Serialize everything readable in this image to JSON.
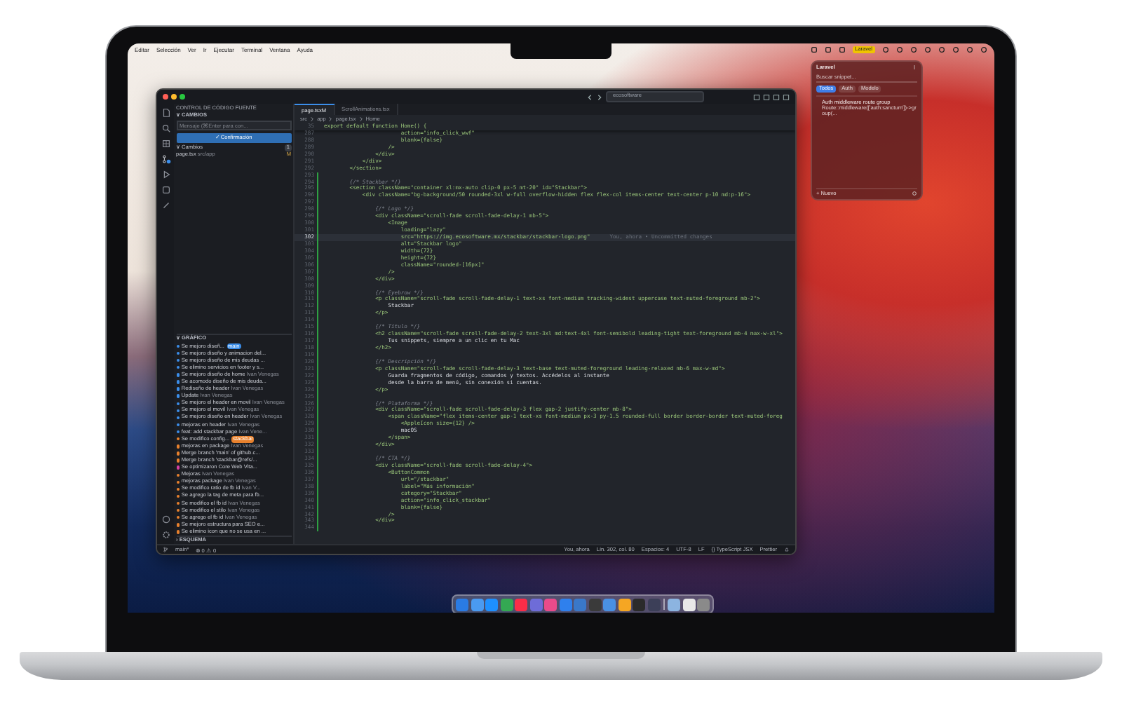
{
  "menu_bar": {
    "items": [
      "Editar",
      "Selección",
      "Ver",
      "Ir",
      "Ejecutar",
      "Terminal",
      "Ventana",
      "Ayuda"
    ],
    "active_app_label": "Laravel"
  },
  "editor_window": {
    "search": "ecosoftware",
    "sidebar": {
      "title": "CONTROL DE CÓDIGO FUENTE",
      "section": "∨ CAMBIOS",
      "message_placeholder": "Mensaje (⌘Enter para con...",
      "commit_button": "✓ Confirmación",
      "changes_label": "∨ Cambios",
      "changes_count": "1",
      "files": [
        {
          "name": "page.tsx",
          "path": "src/app",
          "status": "M"
        }
      ],
      "graph_title": "∨ GRÁFICO",
      "commits": [
        {
          "message": "Se mejoro diseñ...",
          "badge": "main",
          "color": "#3b8eea"
        },
        {
          "message": "Se mejoro diseño y animacion del...",
          "color": "#3b8eea"
        },
        {
          "message": "Se mejoro diseño de mis deudas ...",
          "color": "#3b8eea"
        },
        {
          "message": "Se elimino servicios en footer y s...",
          "color": "#3b8eea"
        },
        {
          "message": "Se mejoro diseño de home",
          "author": "Ivan Venegas",
          "color": "#3b8eea"
        },
        {
          "message": "Se acomodo diseño de mis deuda...",
          "color": "#3b8eea"
        },
        {
          "message": "Rediseño de header",
          "author": "Ivan Venegas",
          "color": "#3b8eea"
        },
        {
          "message": "Update",
          "author": "Ivan Venegas",
          "color": "#3b8eea"
        },
        {
          "message": "Se mejoro el header en movil",
          "author": "Ivan Venegas",
          "color": "#3b8eea"
        },
        {
          "message": "Se mejoro el movil",
          "author": "Ivan Venegas",
          "color": "#3b8eea"
        },
        {
          "message": "Se mejoro diseño en header",
          "author": "Ivan Venegas",
          "color": "#3b8eea"
        },
        {
          "message": "mejoras en header",
          "author": "Ivan Venegas",
          "color": "#3b8eea"
        },
        {
          "message": "feat: add stackbar page",
          "author": "Ivan Vene...",
          "color": "#3b8eea"
        },
        {
          "message": "Se modifico config...",
          "badge": "stackbar",
          "color": "#e8812d"
        },
        {
          "message": "mejoras en package",
          "author": "Ivan Venegas",
          "color": "#e8812d"
        },
        {
          "message": "Merge branch 'main' of github.c...",
          "color": "#e8812d"
        },
        {
          "message": "Merge branch 'stackbar@refs/...",
          "color": "#e8812d"
        },
        {
          "message": "Se optimizaron Core Web Vita...",
          "color": "#d63fa3"
        },
        {
          "message": "Mejoras",
          "author": "Ivan Venegas",
          "color": "#e8812d"
        },
        {
          "message": "mejoras package",
          "author": "Ivan Venegas",
          "color": "#e8812d"
        },
        {
          "message": "Se modifico ratio de fb id",
          "author": "Ivan V...",
          "color": "#e8812d"
        },
        {
          "message": "Se agrego la tag de meta para fb...",
          "color": "#e8812d"
        },
        {
          "message": "Se modifico el fb id",
          "author": "Ivan Venegas",
          "color": "#e8812d"
        },
        {
          "message": "Se modifico el stilo",
          "author": "Ivan Venegas",
          "color": "#e8812d"
        },
        {
          "message": "Se agrego el fb id",
          "author": "Ivan Venegas",
          "color": "#e8812d"
        },
        {
          "message": "Se mejoro estructura para SEO e...",
          "color": "#e8812d"
        },
        {
          "message": "Se elimino icon que no se usa en ...",
          "color": "#e8812d"
        }
      ],
      "outline_title": "› ESQUEMA"
    },
    "tabs": [
      {
        "label": "page.tsx",
        "status": "M",
        "selected": true
      },
      {
        "label": "ScrollAnimations.tsx",
        "selected": false
      }
    ],
    "breadcrumb": [
      "src",
      "app",
      "page.tsx",
      "Home"
    ],
    "lines": [
      {
        "number": "35",
        "text": "export default function Home() {",
        "kind": "markup",
        "added": false,
        "current": false
      },
      {
        "number": "287",
        "text": "                        action=\"info_click_wwf\"",
        "kind": "markup",
        "added": false,
        "current": false
      },
      {
        "number": "288",
        "text": "                        blank={false}",
        "kind": "markup",
        "added": false,
        "current": false
      },
      {
        "number": "289",
        "text": "                    />",
        "kind": "markup",
        "added": false,
        "current": false
      },
      {
        "number": "290",
        "text": "                </div>",
        "kind": "markup",
        "added": false,
        "current": false
      },
      {
        "number": "291",
        "text": "            </div>",
        "kind": "markup",
        "added": false,
        "current": false
      },
      {
        "number": "292",
        "text": "        </section>",
        "kind": "markup",
        "added": false,
        "current": false
      },
      {
        "number": "293",
        "added": true,
        "current": false
      },
      {
        "number": "294",
        "text": "        {/* Stackbar */}",
        "kind": "comment",
        "added": true,
        "current": false
      },
      {
        "number": "295",
        "text": "        <section className=\"container xl:mx-auto clip-0 px-5 mt-20\" id=\"Stackbar\">",
        "kind": "markup",
        "added": true,
        "current": false
      },
      {
        "number": "296",
        "text": "            <div className=\"bg-background/50 rounded-3xl w-full overflow-hidden flex flex-col items-center text-center p-10 md:p-16\">",
        "kind": "markup",
        "added": true,
        "current": false
      },
      {
        "number": "297",
        "added": true,
        "current": false
      },
      {
        "number": "298",
        "text": "                {/* Logo */}",
        "kind": "comment",
        "added": true,
        "current": false
      },
      {
        "number": "299",
        "text": "                <div className=\"scroll-fade scroll-fade-delay-1 mb-5\">",
        "kind": "markup",
        "added": true,
        "current": false
      },
      {
        "number": "300",
        "text": "                    <Image",
        "kind": "markup",
        "added": true,
        "current": false
      },
      {
        "number": "301",
        "text": "                        loading=\"lazy\"",
        "kind": "markup",
        "added": true,
        "current": false
      },
      {
        "number": "302",
        "text": "                        src=\"https://img.ecosoftware.mx/stackbar/stackbar-logo.png\"",
        "kind": "markup",
        "added": true,
        "current": true,
        "blame": "You, ahora • Uncommitted changes"
      },
      {
        "number": "303",
        "text": "                        alt=\"Stackbar logo\"",
        "kind": "markup",
        "added": true,
        "current": false
      },
      {
        "number": "304",
        "text": "                        width={72}",
        "kind": "markup",
        "added": true,
        "current": false
      },
      {
        "number": "305",
        "text": "                        height={72}",
        "kind": "markup",
        "added": true,
        "current": false
      },
      {
        "number": "306",
        "text": "                        className=\"rounded-[16px]\"",
        "kind": "markup",
        "added": true,
        "current": false
      },
      {
        "number": "307",
        "text": "                    />",
        "kind": "markup",
        "added": true,
        "current": false
      },
      {
        "number": "308",
        "text": "                </div>",
        "kind": "markup",
        "added": true,
        "current": false
      },
      {
        "number": "309",
        "added": true,
        "current": false
      },
      {
        "number": "310",
        "text": "                {/* Eyebrow */}",
        "kind": "comment",
        "added": true,
        "current": false
      },
      {
        "number": "311",
        "text": "                <p className=\"scroll-fade scroll-fade-delay-1 text-xs font-medium tracking-widest uppercase text-muted-foreground mb-2\">",
        "kind": "markup",
        "added": true,
        "current": false
      },
      {
        "number": "312",
        "text": "                    Stackbar",
        "kind": "text",
        "added": true,
        "current": false
      },
      {
        "number": "313",
        "text": "                </p>",
        "kind": "markup",
        "added": true,
        "current": false
      },
      {
        "number": "314",
        "added": true,
        "current": false
      },
      {
        "number": "315",
        "text": "                {/* Título */}",
        "kind": "comment",
        "added": true,
        "current": false
      },
      {
        "number": "316",
        "text": "                <h2 className=\"scroll-fade scroll-fade-delay-2 text-3xl md:text-4xl font-semibold leading-tight text-foreground mb-4 max-w-xl\">",
        "kind": "markup",
        "added": true,
        "current": false
      },
      {
        "number": "317",
        "text": "                    Tus snippets, siempre a un clic en tu Mac",
        "kind": "text",
        "added": true,
        "current": false
      },
      {
        "number": "318",
        "text": "                </h2>",
        "kind": "markup",
        "added": true,
        "current": false
      },
      {
        "number": "319",
        "added": true,
        "current": false
      },
      {
        "number": "320",
        "text": "                {/* Descripción */}",
        "kind": "comment",
        "added": true,
        "current": false
      },
      {
        "number": "321",
        "text": "                <p className=\"scroll-fade scroll-fade-delay-3 text-base text-muted-foreground leading-relaxed mb-6 max-w-md\">",
        "kind": "markup",
        "added": true,
        "current": false
      },
      {
        "number": "322",
        "text": "                    Guarda fragmentos de código, comandos y textos. Accédelos al instante",
        "kind": "text",
        "added": true,
        "current": false
      },
      {
        "number": "323",
        "text": "                    desde la barra de menú, sin conexión si cuentas.",
        "kind": "text",
        "added": true,
        "current": false
      },
      {
        "number": "324",
        "text": "                </p>",
        "kind": "markup",
        "added": true,
        "current": false
      },
      {
        "number": "325",
        "added": true,
        "current": false
      },
      {
        "number": "326",
        "text": "                {/* Plataforma */}",
        "kind": "comment",
        "added": true,
        "current": false
      },
      {
        "number": "327",
        "text": "                <div className=\"scroll-fade scroll-fade-delay-3 flex gap-2 justify-center mb-8\">",
        "kind": "markup",
        "added": true,
        "current": false
      },
      {
        "number": "328",
        "text": "                    <span className=\"flex items-center gap-1 text-xs font-medium px-3 py-1.5 rounded-full border border-border text-muted-foreg",
        "kind": "markup",
        "added": true,
        "current": false
      },
      {
        "number": "329",
        "text": "                        <AppleIcon size={12} />",
        "kind": "markup",
        "added": true,
        "current": false
      },
      {
        "number": "330",
        "text": "                        macOS",
        "kind": "text",
        "added": true,
        "current": false
      },
      {
        "number": "331",
        "text": "                    </span>",
        "kind": "markup",
        "added": true,
        "current": false
      },
      {
        "number": "332",
        "text": "                </div>",
        "kind": "markup",
        "added": true,
        "current": false
      },
      {
        "number": "333",
        "added": true,
        "current": false
      },
      {
        "number": "334",
        "text": "                {/* CTA */}",
        "kind": "comment",
        "added": true,
        "current": false
      },
      {
        "number": "335",
        "text": "                <div className=\"scroll-fade scroll-fade-delay-4\">",
        "kind": "markup",
        "added": true,
        "current": false
      },
      {
        "number": "336",
        "text": "                    <ButtonCommon",
        "kind": "markup",
        "added": true,
        "current": false
      },
      {
        "number": "337",
        "text": "                        url=\"/stackbar\"",
        "kind": "markup",
        "added": true,
        "current": false
      },
      {
        "number": "338",
        "text": "                        label=\"Más información\"",
        "kind": "markup",
        "added": true,
        "current": false
      },
      {
        "number": "339",
        "text": "                        category=\"Stackbar\"",
        "kind": "markup",
        "added": true,
        "current": false
      },
      {
        "number": "340",
        "text": "                        action=\"info_click_stackbar\"",
        "kind": "markup",
        "added": true,
        "current": false
      },
      {
        "number": "341",
        "text": "                        blank={false}",
        "kind": "markup",
        "added": true,
        "current": false
      },
      {
        "number": "342",
        "text": "                    />",
        "kind": "markup",
        "added": true,
        "current": false
      },
      {
        "number": "343",
        "text": "                </div>",
        "kind": "markup",
        "added": true,
        "current": false
      },
      {
        "number": "344",
        "added": true,
        "current": false
      }
    ],
    "status_bar": {
      "branch": "main*",
      "problems": "⊗ 0 ⚠ 0",
      "items": [
        "You, ahora",
        "Lín. 302, col. 80",
        "Espacios: 4",
        "UTF-8",
        "LF",
        "{} TypeScript JSX",
        "Prettier"
      ]
    }
  },
  "snippet_popup": {
    "title": "Laravel",
    "search_placeholder": "Buscar snippet...",
    "filters": [
      {
        "label": "Todos",
        "selected": true
      },
      {
        "label": "Auth",
        "selected": false
      },
      {
        "label": "Modelo",
        "selected": false
      }
    ],
    "snippets": [
      {
        "title": "Auth middleware route group",
        "preview": "Route::middleware(['auth:sanctum'])->group(..."
      }
    ],
    "new_button": "+ Nuevo"
  }
}
